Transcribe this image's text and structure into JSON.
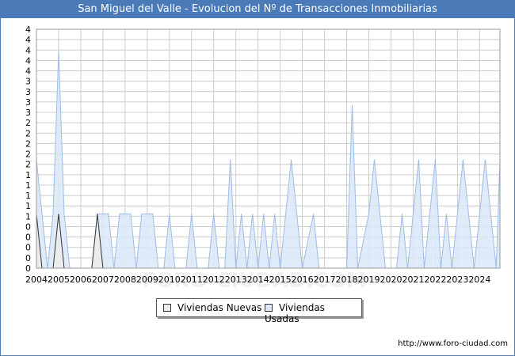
{
  "title": "San Miguel del Valle - Evolucion del Nº de Transacciones Inmobiliarias",
  "source": "http://www.foro-ciudad.com",
  "watermark": "FORO-CIUDAD.COM",
  "colors": {
    "header_bg": "#4a7ab8",
    "nuevas_fill": "#ececec",
    "nuevas_stroke": "#333333",
    "usadas_fill": "#dbe8f8",
    "usadas_stroke": "#9dbce6",
    "grid": "#cccccc"
  },
  "chart_data": {
    "type": "area",
    "title": "San Miguel del Valle - Evolucion del Nº de Transacciones Inmobiliarias",
    "xlabel": "",
    "ylabel": "",
    "x_labels": [
      "2004",
      "2005",
      "2006",
      "2007",
      "2008",
      "2009",
      "2010",
      "2011",
      "2012",
      "2013",
      "2014",
      "2015",
      "2016",
      "2017",
      "2018",
      "2019",
      "2020",
      "2021",
      "2022",
      "2023",
      "2024"
    ],
    "y_tick_labels": [
      "0",
      "0",
      "0",
      "0",
      "0",
      "1",
      "1",
      "1",
      "1",
      "1",
      "2",
      "2",
      "2",
      "2",
      "2",
      "3",
      "3",
      "3",
      "3",
      "4",
      "4",
      "4",
      "4",
      "4"
    ],
    "ylim": [
      0,
      4.4
    ],
    "x_range": [
      "2004-01",
      "2024-12"
    ],
    "grid": true,
    "legend_position": "bottom",
    "series": [
      {
        "name": "Viviendas Nuevas",
        "points": [
          [
            "2004-01",
            1
          ],
          [
            "2004-04",
            0
          ],
          [
            "2004-10",
            0
          ],
          [
            "2005-01",
            1
          ],
          [
            "2005-04",
            0
          ],
          [
            "2006-07",
            0
          ],
          [
            "2006-10",
            1
          ],
          [
            "2007-01",
            0
          ]
        ]
      },
      {
        "name": "Viviendas Usadas",
        "points": [
          [
            "2004-01",
            2
          ],
          [
            "2004-04",
            1
          ],
          [
            "2004-07",
            0
          ],
          [
            "2004-10",
            1
          ],
          [
            "2005-01",
            4
          ],
          [
            "2005-04",
            1
          ],
          [
            "2005-07",
            0
          ],
          [
            "2006-07",
            0
          ],
          [
            "2006-10",
            1
          ],
          [
            "2007-01",
            1
          ],
          [
            "2007-04",
            1
          ],
          [
            "2007-07",
            0
          ],
          [
            "2007-10",
            1
          ],
          [
            "2008-01",
            1
          ],
          [
            "2008-04",
            1
          ],
          [
            "2008-07",
            0
          ],
          [
            "2008-10",
            1
          ],
          [
            "2009-01",
            1
          ],
          [
            "2009-04",
            1
          ],
          [
            "2009-07",
            0
          ],
          [
            "2009-10",
            0
          ],
          [
            "2010-01",
            1
          ],
          [
            "2010-04",
            0
          ],
          [
            "2010-10",
            0
          ],
          [
            "2011-01",
            1
          ],
          [
            "2011-04",
            0
          ],
          [
            "2011-10",
            0
          ],
          [
            "2012-01",
            1
          ],
          [
            "2012-04",
            0
          ],
          [
            "2012-07",
            0
          ],
          [
            "2012-10",
            2
          ],
          [
            "2013-01",
            0
          ],
          [
            "2013-04",
            1
          ],
          [
            "2013-07",
            0
          ],
          [
            "2013-10",
            1
          ],
          [
            "2014-01",
            0
          ],
          [
            "2014-04",
            1
          ],
          [
            "2014-07",
            0
          ],
          [
            "2014-10",
            1
          ],
          [
            "2015-01",
            0
          ],
          [
            "2015-04",
            1
          ],
          [
            "2015-07",
            2
          ],
          [
            "2015-10",
            1
          ],
          [
            "2016-01",
            0
          ],
          [
            "2016-07",
            1
          ],
          [
            "2016-10",
            0
          ],
          [
            "2018-01",
            0
          ],
          [
            "2018-04",
            3
          ],
          [
            "2018-07",
            0
          ],
          [
            "2019-01",
            1
          ],
          [
            "2019-04",
            2
          ],
          [
            "2019-07",
            1
          ],
          [
            "2019-10",
            0
          ],
          [
            "2020-04",
            0
          ],
          [
            "2020-07",
            1
          ],
          [
            "2020-10",
            0
          ],
          [
            "2021-01",
            1
          ],
          [
            "2021-04",
            2
          ],
          [
            "2021-07",
            0
          ],
          [
            "2021-10",
            1
          ],
          [
            "2022-01",
            2
          ],
          [
            "2022-04",
            0
          ],
          [
            "2022-07",
            1
          ],
          [
            "2022-10",
            0
          ],
          [
            "2023-01",
            1
          ],
          [
            "2023-04",
            2
          ],
          [
            "2023-07",
            1
          ],
          [
            "2023-10",
            0
          ],
          [
            "2024-01",
            1
          ],
          [
            "2024-04",
            2
          ],
          [
            "2024-07",
            1
          ],
          [
            "2024-10",
            0
          ],
          [
            "2024-12",
            2
          ]
        ]
      }
    ]
  }
}
